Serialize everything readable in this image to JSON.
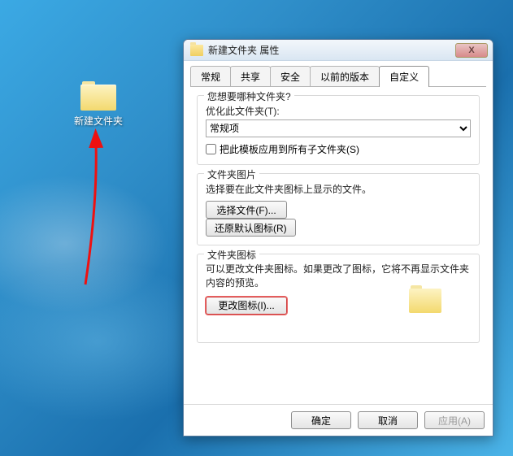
{
  "desktop": {
    "folder_label": "新建文件夹"
  },
  "dialog": {
    "title": "新建文件夹 属性",
    "close_glyph": "X",
    "tabs": [
      {
        "label": "常规"
      },
      {
        "label": "共享"
      },
      {
        "label": "安全"
      },
      {
        "label": "以前的版本"
      },
      {
        "label": "自定义"
      }
    ],
    "active_tab_index": 4,
    "section1": {
      "legend": "您想要哪种文件夹?",
      "optimize_label": "优化此文件夹(T):",
      "dropdown_value": "常规项",
      "checkbox_label": "把此模板应用到所有子文件夹(S)"
    },
    "section2": {
      "legend": "文件夹图片",
      "desc": "选择要在此文件夹图标上显示的文件。",
      "choose_button": "选择文件(F)...",
      "restore_button": "还原默认图标(R)"
    },
    "section3": {
      "legend": "文件夹图标",
      "desc": "可以更改文件夹图标。如果更改了图标，它将不再显示文件夹内容的预览。",
      "change_button": "更改图标(I)..."
    },
    "footer": {
      "ok": "确定",
      "cancel": "取消",
      "apply": "应用(A)"
    }
  }
}
